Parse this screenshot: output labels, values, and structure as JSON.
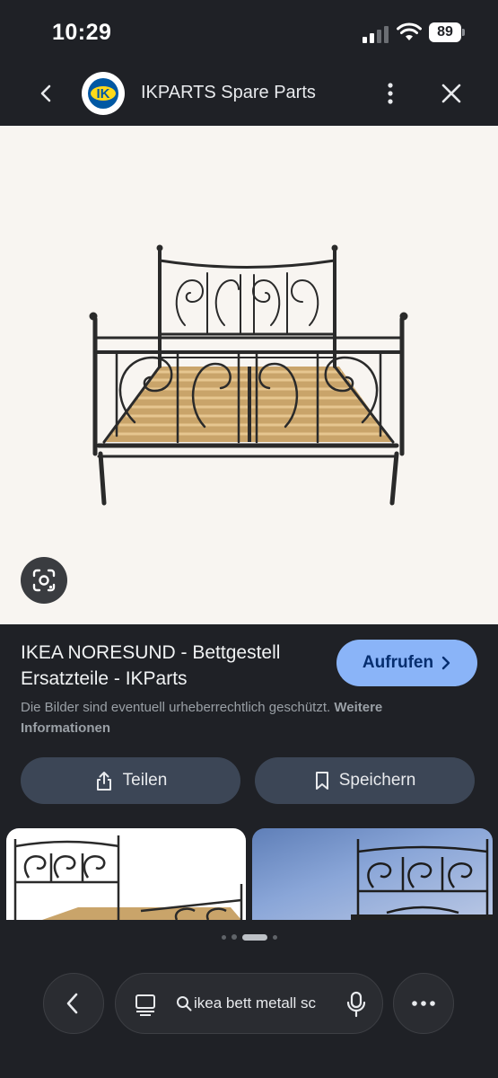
{
  "status_bar": {
    "time": "10:29",
    "battery": "89"
  },
  "header": {
    "logo_text": "IK",
    "title": "IKPARTS Spare Parts"
  },
  "result": {
    "title": "IKEA NORESUND - Bettgestell Ersatzteile - IKParts",
    "visit_label": "Aufrufen",
    "copyright_text": "Die Bilder sind eventuell urheberrechtlich geschützt.",
    "copyright_link": "Weitere Informationen"
  },
  "actions": {
    "share_label": "Teilen",
    "save_label": "Speichern"
  },
  "bottom_bar": {
    "search_query": "ikea bett metall sc"
  },
  "icons": [
    "signal-icon",
    "wifi-icon",
    "back-icon",
    "more-vert-icon",
    "close-icon",
    "lens-icon",
    "chevron-right-icon",
    "share-icon",
    "bookmark-icon",
    "tabs-icon",
    "search-icon",
    "mic-icon",
    "more-horiz-icon"
  ],
  "colors": {
    "background": "#1f2126",
    "accent": "#8ab4f8",
    "pill": "#3c4656",
    "image_bg": "#f8f5f1"
  }
}
